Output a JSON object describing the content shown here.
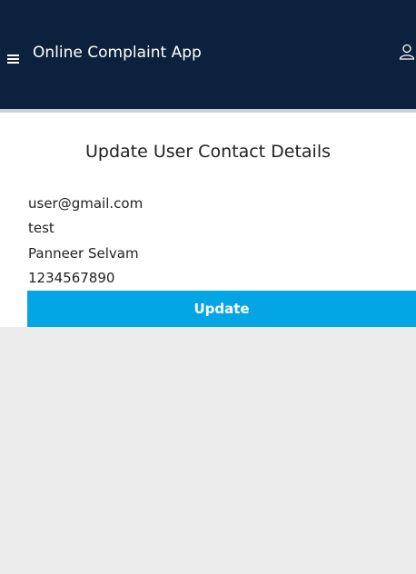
{
  "header": {
    "title": "Online Complaint App",
    "menu_icon": "hamburger-menu-icon",
    "user_icon": "user-profile-icon"
  },
  "main": {
    "title": "Update User Contact Details",
    "fields": {
      "email": "user@gmail.com",
      "password": "test",
      "name": "Panneer Selvam",
      "phone": "1234567890"
    },
    "update_label": "Update"
  },
  "colors": {
    "header_bg": "#0c223c",
    "button_bg": "#04a5e5",
    "page_bg": "#ececec"
  }
}
